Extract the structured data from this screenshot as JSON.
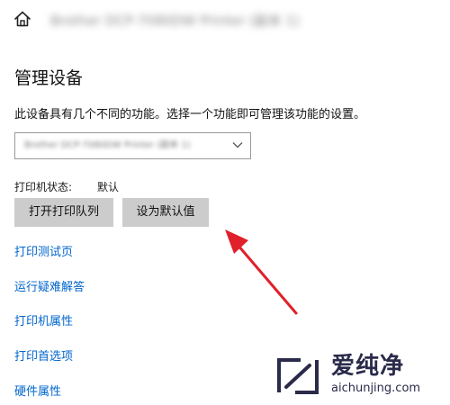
{
  "header": {
    "home_icon": "home-icon",
    "title": "Brother DCP-7080DW Printer (副本 1)"
  },
  "main": {
    "heading": "管理设备",
    "description": "此设备具有几个不同的功能。选择一个功能即可管理该功能的设置。",
    "device_select": {
      "value": "Brother DCP-7080DW Printer (副本 1)",
      "chevron_icon": "chevron-down-icon"
    },
    "status": {
      "label": "打印机状态:",
      "value": "默认"
    },
    "buttons": {
      "open_queue": "打开打印队列",
      "set_default": "设为默认值"
    },
    "links": [
      "打印测试页",
      "运行疑难解答",
      "打印机属性",
      "打印首选项",
      "硬件属性"
    ]
  },
  "annotation": {
    "arrow_color": "#e0202a"
  },
  "watermark": {
    "name": "爱纯净",
    "url": "aichunjing.com"
  },
  "colors": {
    "link": "#0066cc",
    "button_bg": "#cccccc",
    "watermark": "#2a2a4a"
  }
}
